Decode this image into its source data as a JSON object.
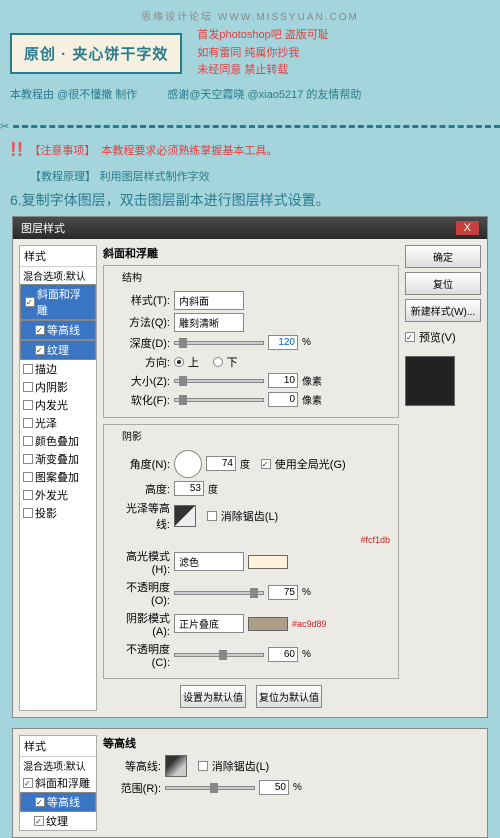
{
  "watermark": "思缘设计论坛   WWW.MISSYUAN.COM",
  "title": "原创 · 夹心饼干字效",
  "warn1": "首发photoshop吧 盗版可耻",
  "warn2": "如有雷同 纯属你抄我",
  "warn3": "未经同意 禁止转载",
  "credit1": "本教程由 @很不懂撒 制作",
  "credit2": "感谢@天空霞晓 @xiao5217 的友情帮助",
  "notice_label": "【注意事项】",
  "notice_text": "本教程要求必须熟练掌握基本工具。",
  "principle_label": "【教程原理】",
  "principle_text": "利用图层样式制作字效",
  "step": "6.复制字体图层，双击图层副本进行图层样式设置。",
  "dlg": {
    "title": "图层样式",
    "styles_head": "样式",
    "blend_default": "混合选项:默认",
    "items": [
      "斜面和浮雕",
      "等高线",
      "纹理",
      "描边",
      "内阴影",
      "内发光",
      "光泽",
      "颜色叠加",
      "渐变叠加",
      "图案叠加",
      "外发光",
      "投影"
    ],
    "checked": [
      true,
      true,
      true,
      false,
      false,
      false,
      false,
      false,
      false,
      false,
      false,
      false
    ],
    "btn_ok": "确定",
    "btn_cancel": "复位",
    "btn_new": "新建样式(W)...",
    "preview_label": "预览(V)",
    "main_title": "斜面和浮雕",
    "struct": {
      "title": "结构",
      "style_label": "样式(T):",
      "style_val": "内斜面",
      "method_label": "方法(Q):",
      "method_val": "雕刻清晰",
      "depth_label": "深度(D):",
      "depth_val": "120",
      "depth_unit": "%",
      "dir_label": "方向:",
      "up": "上",
      "down": "下",
      "size_label": "大小(Z):",
      "size_val": "10",
      "size_unit": "像素",
      "soft_label": "软化(F):",
      "soft_val": "0",
      "soft_unit": "像素"
    },
    "shade": {
      "title": "阴影",
      "angle_label": "角度(N):",
      "angle_val": "74",
      "angle_unit": "度",
      "global": "使用全局光(G)",
      "alt_label": "高度:",
      "alt_val": "53",
      "alt_unit": "度",
      "gloss_label": "光泽等高线:",
      "antialias": "消除锯齿(L)",
      "hl_mode_label": "高光模式(H):",
      "hl_mode": "滤色",
      "hl_hex": "#fcf1db",
      "hl_op_label": "不透明度(O):",
      "hl_op": "75",
      "op_unit": "%",
      "sh_mode_label": "阴影模式(A):",
      "sh_mode": "正片叠底",
      "sh_hex": "#ac9d89",
      "sh_op_label": "不透明度(C):",
      "sh_op": "60"
    },
    "set_default": "设置为默认值",
    "reset_default": "复位为默认值"
  },
  "dlg2": {
    "title": "等高线",
    "contour_label": "等高线:",
    "antialias": "消除锯齿(L)",
    "range_label": "范围(R):",
    "range_val": "50",
    "range_unit": "%"
  },
  "colors": {
    "hl_swatch": "#fcf1db",
    "sh_swatch": "#ac9d89"
  }
}
